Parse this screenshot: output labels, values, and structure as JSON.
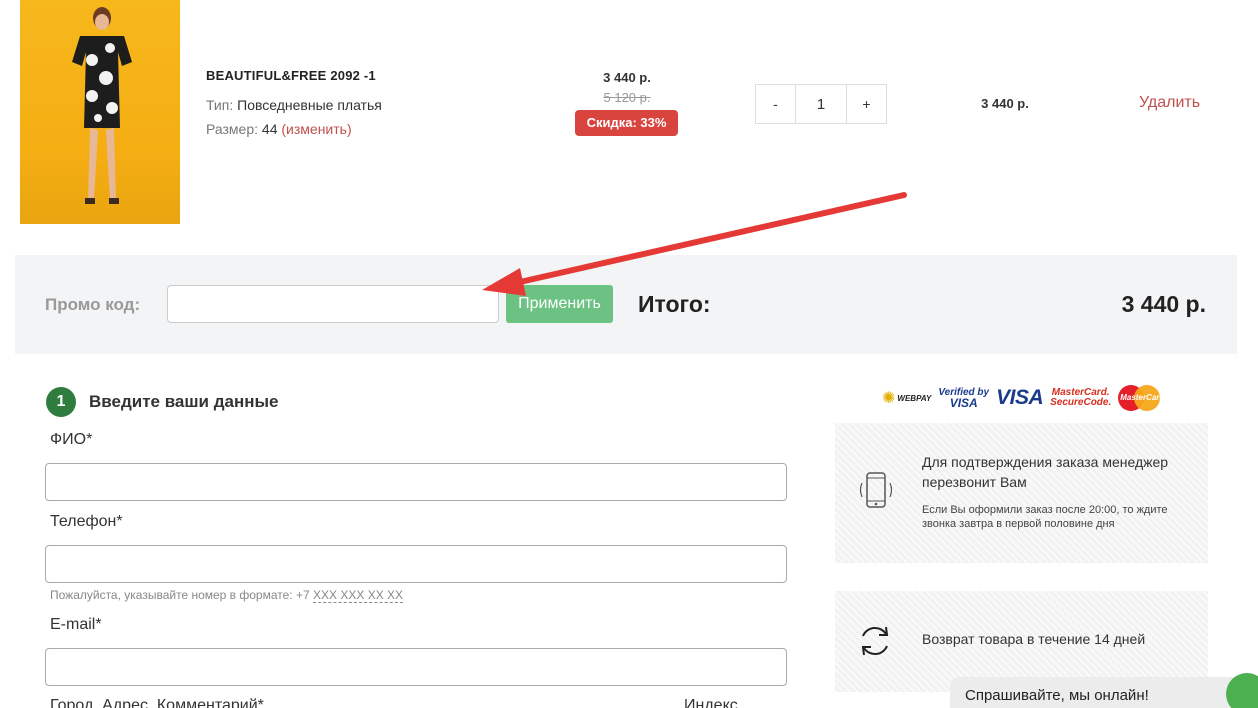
{
  "cart_item": {
    "name": "BEAUTIFUL&FREE 2092 -1",
    "type_label": "Тип:",
    "type_value": "Повседневные платья",
    "size_label": "Размер:",
    "size_value": "44",
    "size_change": "(изменить)",
    "price": "3 440 р.",
    "old_price": "5 120 р.",
    "discount": "Скидка: 33%",
    "qty_minus": "-",
    "quantity": "1",
    "qty_plus": "+",
    "row_total": "3 440 р.",
    "remove_label": "Удалить"
  },
  "promo": {
    "label": "Промо код:",
    "input_value": "",
    "apply_label": "Применить",
    "total_label": "Итого:",
    "total_value": "3 440 р."
  },
  "form": {
    "step_number": "1",
    "step_title": "Введите ваши данные",
    "fio_label": "ФИО*",
    "phone_label": "Телефон*",
    "phone_hint_prefix": "Пожалуйста, указывайте номер в формате: +7",
    "phone_hint_format": "XXX XXX XX XX",
    "email_label": "E-mail*",
    "address_label": "Город, Адрес, Комментарий*",
    "index_label": "Индекс"
  },
  "payment_logos": {
    "webpay": "WEBPAY",
    "verified_line1": "Verified by",
    "verified_line2": "VISA",
    "visa": "VISA",
    "mc_securecode_line1": "MasterCard.",
    "mc_securecode_line2": "SecureCode.",
    "mastercard": "MasterCard"
  },
  "info": {
    "confirm_title": "Для подтверждения заказа менеджер перезвонит Вам",
    "confirm_note": "Если Вы оформили заказ после 20:00, то ждите звонка завтра в первой половине дня",
    "return_title": "Возврат товара в течение 14 дней"
  },
  "chat": {
    "label": "Спрашивайте, мы онлайн!"
  },
  "colors": {
    "accent_green": "#6cc282",
    "step_green": "#2e7d3f",
    "discount_red": "#d9443f",
    "link_red": "#c0504d",
    "arrow_red": "#e53935"
  },
  "icons": [
    "phone-icon",
    "refresh-icon",
    "webpay-star-icon"
  ]
}
